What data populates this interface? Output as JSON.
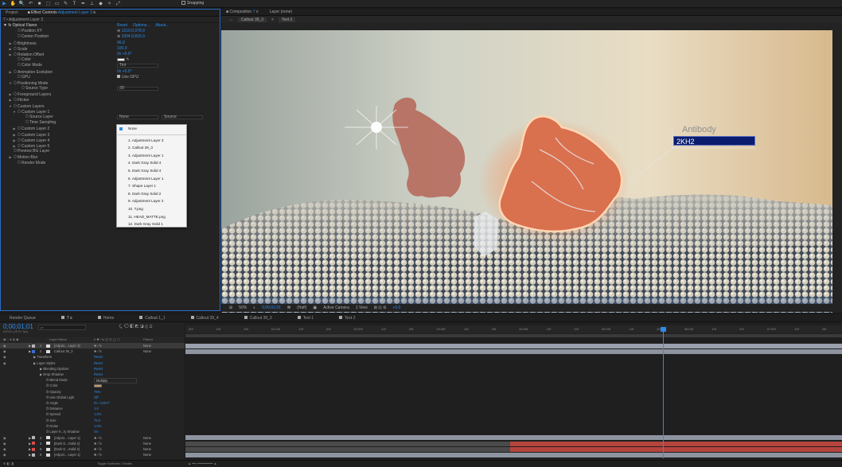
{
  "toolbar": {
    "tools": [
      "▶",
      "✋",
      "🔍",
      "↶",
      "■",
      "⬚",
      "▭",
      "✎",
      "T",
      "✒",
      "⊥",
      "◆",
      "✧",
      "⤢"
    ],
    "snapping_label": "Snapping"
  },
  "left_panel": {
    "tab_project": "Project",
    "tab_effect_controls": "Effect Controls",
    "tab_effect_controls_layer": "Adjustment Layer 3",
    "title": "7 • Adjustment Layer 3",
    "effect_name": "Optical Flares",
    "effect_links": [
      "Reset",
      "Options...",
      "About..."
    ],
    "properties": [
      {
        "label": "Position XY",
        "value": "1210.0,378.0",
        "indent": 2,
        "type": "point"
      },
      {
        "label": "Center Position",
        "value": "1004.0,815.0",
        "indent": 2,
        "type": "point"
      },
      {
        "label": "Brightness",
        "value": "96.0",
        "indent": 1,
        "twirl": true
      },
      {
        "label": "Scale",
        "value": "100.0",
        "indent": 1,
        "twirl": true
      },
      {
        "label": "Rotation Offset",
        "value": "0x +0.0°",
        "indent": 1,
        "twirl": true
      },
      {
        "label": "Color",
        "value": "",
        "indent": 2,
        "type": "swatch"
      },
      {
        "label": "Color Mode",
        "value": "Tint",
        "indent": 2,
        "type": "dropdown"
      },
      {
        "label": "Animation Evolution",
        "value": "0x +0.0°",
        "indent": 1,
        "twirl": true
      },
      {
        "label": "GPU",
        "value": "Use GPU",
        "indent": 2,
        "type": "checkbox"
      },
      {
        "label": "Positioning Mode",
        "value": "",
        "indent": 1,
        "twirl": true,
        "open": true
      },
      {
        "label": "Source Type",
        "value": "2D",
        "indent": 3,
        "type": "dropdown"
      },
      {
        "label": "Foreground Layers",
        "value": "",
        "indent": 1,
        "twirl": true
      },
      {
        "label": "Flicker",
        "value": "",
        "indent": 1,
        "twirl": true
      },
      {
        "label": "Custom Layers",
        "value": "",
        "indent": 1,
        "twirl": true,
        "open": true
      },
      {
        "label": "Custom Layer 1",
        "value": "",
        "indent": 2,
        "twirl": true,
        "open": true
      },
      {
        "label": "Source Layer",
        "value": "None",
        "indent": 4,
        "type": "layerdd"
      },
      {
        "label": "Time Sampling",
        "value": "",
        "indent": 4
      },
      {
        "label": "Custom Layer 2",
        "value": "",
        "indent": 2,
        "twirl": true
      },
      {
        "label": "Custom Layer 3",
        "value": "",
        "indent": 2,
        "twirl": true
      },
      {
        "label": "Custom Layer 4",
        "value": "",
        "indent": 2,
        "twirl": true
      },
      {
        "label": "Custom Layer 5",
        "value": "",
        "indent": 2,
        "twirl": true
      },
      {
        "label": "Preview BG Layer",
        "value": "",
        "indent": 1
      },
      {
        "label": "Motion Blur",
        "value": "",
        "indent": 1,
        "twirl": true
      },
      {
        "label": "Render Mode",
        "value": "",
        "indent": 2
      }
    ],
    "source_second_dropdown": "Source",
    "layer_dropdown": {
      "selected": "None",
      "items": [
        "1. Adjustment Layer 3",
        "2. Callout 39_3",
        "3. Adjustment Layer 1",
        "4. Dark Gray Solid 4",
        "5. Dark Gray Solid 4",
        "6. Adjustment Layer 1",
        "7. Shape Layer 1",
        "8. Dark Gray Solid 2",
        "9. Adjustment Layer 2",
        "10. T.png",
        "11. HEAD_MATTE.png",
        "12. Dark Gray Solid 1"
      ]
    }
  },
  "comp_panel": {
    "tab_composition": "Composition",
    "tab_composition_name": "7",
    "tab_layer": "Layer (none)",
    "breadcrumbs": [
      "Callout 39_3",
      "Text 2"
    ],
    "callout_title": "Antibody",
    "callout_label": "2KH2",
    "footer": {
      "zoom": "50%",
      "timecode": "0;00;01;01",
      "resolution": "(Half)",
      "camera": "Active Camera",
      "view": "1 View",
      "exposure": "+0.0"
    }
  },
  "timeline_tabs": [
    "Render Queue",
    "7",
    "Home",
    "Callout 1_1",
    "Callout 39_4",
    "Callout 39_3",
    "Text 1",
    "Text 2"
  ],
  "timeline": {
    "timecode": "0;00;01;01",
    "timecode_sub": "00031 (29.97 fps)",
    "search_placeholder": "ρ•",
    "col_headers": {
      "layer_name": "Layer Name",
      "switches": "# ✱ \\ fx ◰ ◎ ◯ ⬡",
      "parent": "Parent"
    },
    "layers_top": [
      {
        "num": "1",
        "name": "[Adjust... Layer 3]",
        "color": "#b4b4b4",
        "parent": "None",
        "selected": true
      },
      {
        "num": "2",
        "name": "Callout 39_3",
        "color": "#3a6bd6",
        "parent": "None",
        "selected": false
      }
    ],
    "props": [
      {
        "label": "Transform",
        "value": "Reset",
        "indent": 1
      },
      {
        "label": "Layer Styles",
        "value": "Reset",
        "indent": 1
      },
      {
        "label": "Blending Options",
        "value": "Reset",
        "indent": 2
      },
      {
        "label": "Drop Shadow",
        "value": "Reset",
        "indent": 2
      },
      {
        "label": "Blend Mode",
        "value": "Multiply",
        "indent": 3
      },
      {
        "label": "Color",
        "value": "",
        "indent": 3
      },
      {
        "label": "Opacity",
        "value": "75%",
        "indent": 3
      },
      {
        "label": "Use Global Light",
        "value": "Off",
        "indent": 3
      },
      {
        "label": "Angle",
        "value": "0x +120.0°",
        "indent": 3
      },
      {
        "label": "Distance",
        "value": "1.0",
        "indent": 3
      },
      {
        "label": "Spread",
        "value": "1.0%",
        "indent": 3
      },
      {
        "label": "Size",
        "value": "75.0",
        "indent": 3
      },
      {
        "label": "Noise",
        "value": "1.0%",
        "indent": 3
      },
      {
        "label": "Layer K...ly Shadow",
        "value": "On",
        "indent": 3
      }
    ],
    "layers_bottom": [
      {
        "num": "3",
        "name": "[Adjust... Layer 1]",
        "color": "#b4b4b4",
        "parent": "None"
      },
      {
        "num": "4",
        "name": "[Dark G...Solid 4]",
        "color": "#d94a4a",
        "parent": "None"
      },
      {
        "num": "5",
        "name": "[Dark G...Solid 4]",
        "color": "#d94a4a",
        "parent": "None"
      },
      {
        "num": "6",
        "name": "[Adjust... Layer 1]",
        "color": "#b4b4b4",
        "parent": "None"
      }
    ],
    "ruler_ticks": [
      "00f",
      "10f",
      "20f",
      "01:00f",
      "10f",
      "20f",
      "02:00f",
      "10f",
      "20f",
      "03:00f",
      "10f",
      "20f",
      "04:00f",
      "10f",
      "20f",
      "05:00f",
      "10f",
      "20f",
      "06:00f",
      "10f",
      "20f",
      "07:00f",
      "10f",
      "20f"
    ],
    "toggle_label": "Toggle Switches / Modes"
  },
  "colors": {
    "accent": "#2d8ceb",
    "callout_bg": "#0a1c6e",
    "red_bar": "#b5443e",
    "gray_bar": "#8e93a0"
  }
}
